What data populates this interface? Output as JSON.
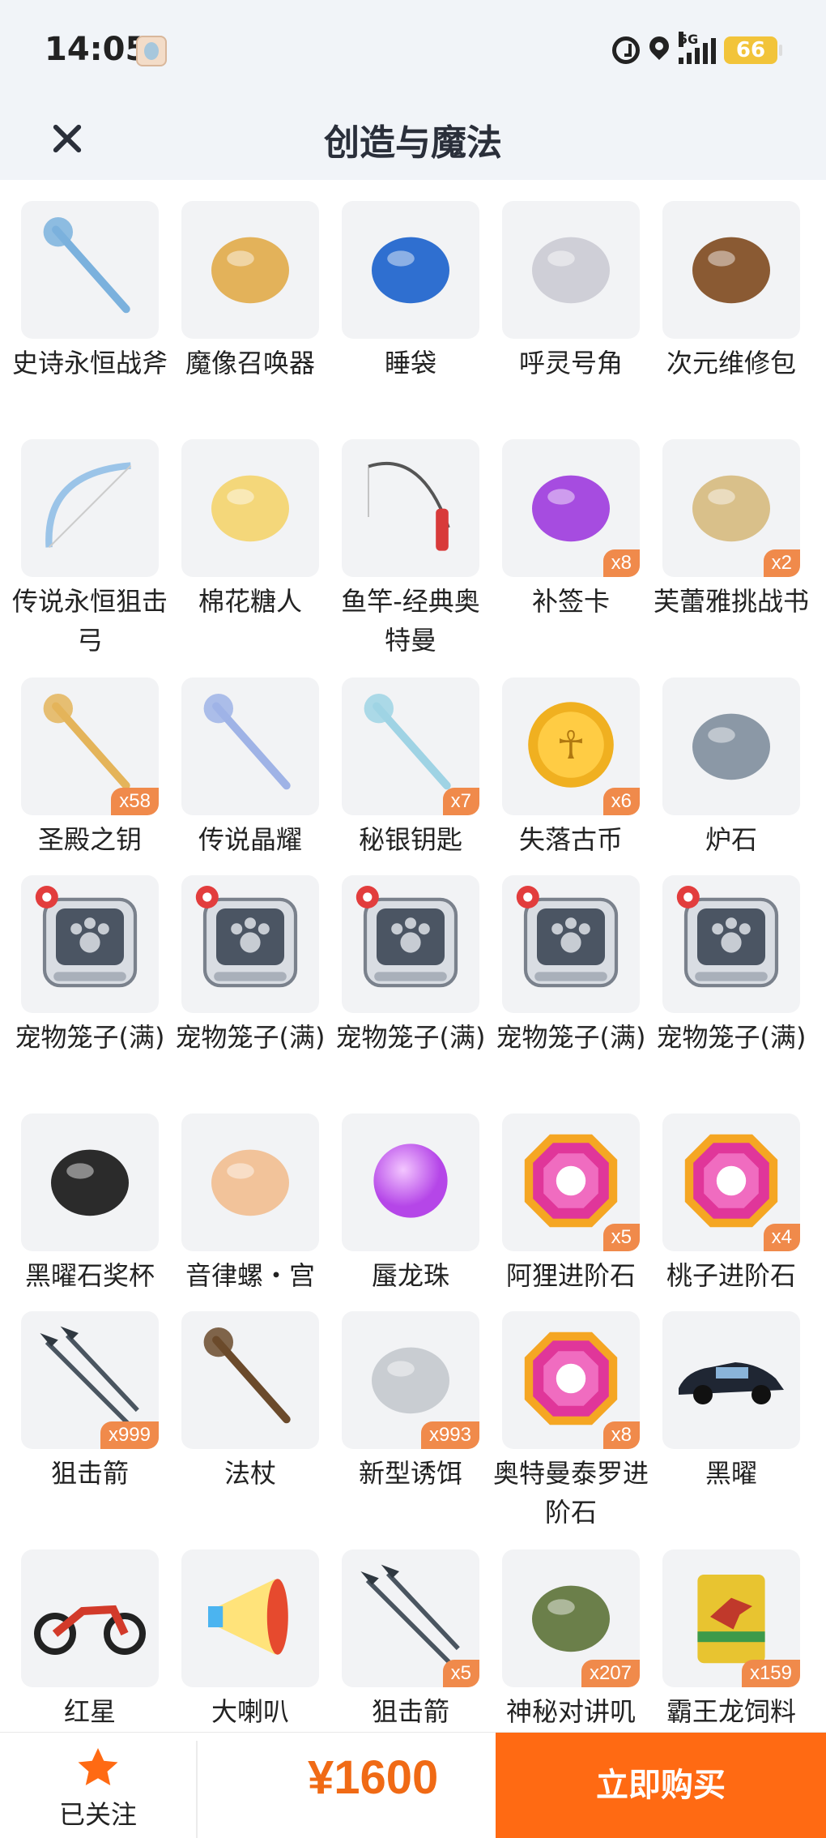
{
  "status_bar": {
    "time": "14:05",
    "network": "5G",
    "battery": "66"
  },
  "header": {
    "title": "创造与魔法"
  },
  "items": [
    {
      "label": "史诗永恒战斧",
      "qty": "",
      "icon": "axe-icon",
      "color": "#7bb1dd"
    },
    {
      "label": "魔像召唤器",
      "qty": "",
      "icon": "golem-summoner-icon",
      "color": "#e3b25a"
    },
    {
      "label": "睡袋",
      "qty": "",
      "icon": "sleeping-bag-icon",
      "color": "#2f6fd0"
    },
    {
      "label": "呼灵号角",
      "qty": "",
      "icon": "horn-icon",
      "color": "#cfcfd7"
    },
    {
      "label": "次元维修包",
      "qty": "",
      "icon": "repair-bag-icon",
      "color": "#8a5a33"
    },
    {
      "label": "传说永恒狙击弓",
      "qty": "",
      "icon": "bow-icon",
      "color": "#9bc4e8"
    },
    {
      "label": "棉花糖人",
      "qty": "",
      "icon": "marshmallow-man-icon",
      "color": "#f4d77a"
    },
    {
      "label": "鱼竿-经典奥特曼",
      "qty": "",
      "icon": "fishing-rod-icon",
      "color": "#d83a3a"
    },
    {
      "label": "补签卡",
      "qty": "x8",
      "icon": "makeup-card-icon",
      "color": "#a64ce0"
    },
    {
      "label": "芙蕾雅挑战书",
      "qty": "x2",
      "icon": "challenge-letter-icon",
      "color": "#d9c08a"
    },
    {
      "label": "圣殿之钥",
      "qty": "x58",
      "icon": "temple-key-icon",
      "color": "#e4b45a"
    },
    {
      "label": "传说晶耀",
      "qty": "",
      "icon": "crystal-blade-icon",
      "color": "#9fb3e6"
    },
    {
      "label": "秘银钥匙",
      "qty": "x7",
      "icon": "mithril-key-icon",
      "color": "#9fd3e4"
    },
    {
      "label": "失落古币",
      "qty": "x6",
      "icon": "ancient-coin-icon",
      "color": "#f0b020"
    },
    {
      "label": "炉石",
      "qty": "",
      "icon": "hearthstone-icon",
      "color": "#8b98a6"
    },
    {
      "label": "宠物笼子(满)",
      "qty": "",
      "icon": "pet-cage-icon",
      "color": "#4b5563"
    },
    {
      "label": "宠物笼子(满)",
      "qty": "",
      "icon": "pet-cage-icon",
      "color": "#4b5563"
    },
    {
      "label": "宠物笼子(满)",
      "qty": "",
      "icon": "pet-cage-icon",
      "color": "#4b5563"
    },
    {
      "label": "宠物笼子(满)",
      "qty": "",
      "icon": "pet-cage-icon",
      "color": "#4b5563"
    },
    {
      "label": "宠物笼子(满)",
      "qty": "",
      "icon": "pet-cage-icon",
      "color": "#4b5563"
    },
    {
      "label": "黑曜石奖杯",
      "qty": "",
      "icon": "obsidian-trophy-icon",
      "color": "#2b2b2b"
    },
    {
      "label": "音律螺・宫",
      "qty": "",
      "icon": "conch-icon",
      "color": "#f2c39a"
    },
    {
      "label": "蜃龙珠",
      "qty": "",
      "icon": "dragon-pearl-icon",
      "color": "#b546e8"
    },
    {
      "label": "阿狸进阶石",
      "qty": "x5",
      "icon": "ali-stone-icon",
      "color": "#e0369a"
    },
    {
      "label": "桃子进阶石",
      "qty": "x4",
      "icon": "peach-stone-icon",
      "color": "#e0369a"
    },
    {
      "label": "狙击箭",
      "qty": "x999",
      "icon": "sniper-arrow-icon",
      "color": "#4a5560"
    },
    {
      "label": "法杖",
      "qty": "",
      "icon": "staff-icon",
      "color": "#6b4a2b"
    },
    {
      "label": "新型诱饵",
      "qty": "x993",
      "icon": "bait-icon",
      "color": "#c9cdd2"
    },
    {
      "label": "奥特曼泰罗进阶石",
      "qty": "x8",
      "icon": "taro-stone-icon",
      "color": "#e0369a"
    },
    {
      "label": "黑曜",
      "qty": "",
      "icon": "car-icon",
      "color": "#1f2633"
    },
    {
      "label": "红星",
      "qty": "",
      "icon": "motorcycle-icon",
      "color": "#333333"
    },
    {
      "label": "大喇叭",
      "qty": "",
      "icon": "megaphone-icon",
      "color": "#f0c020"
    },
    {
      "label": "狙击箭",
      "qty": "x5",
      "icon": "sniper-arrow-icon",
      "color": "#4a5560"
    },
    {
      "label": "神秘对讲叽",
      "qty": "x207",
      "icon": "walkie-talkie-icon",
      "color": "#6b7f4a"
    },
    {
      "label": "霸王龙饲料",
      "qty": "x159",
      "icon": "trex-food-icon",
      "color": "#e8c430"
    }
  ],
  "footer": {
    "follow_label": "已关注",
    "price": "¥1600",
    "buy_label": "立即购买",
    "accent": "#ff6a13"
  }
}
